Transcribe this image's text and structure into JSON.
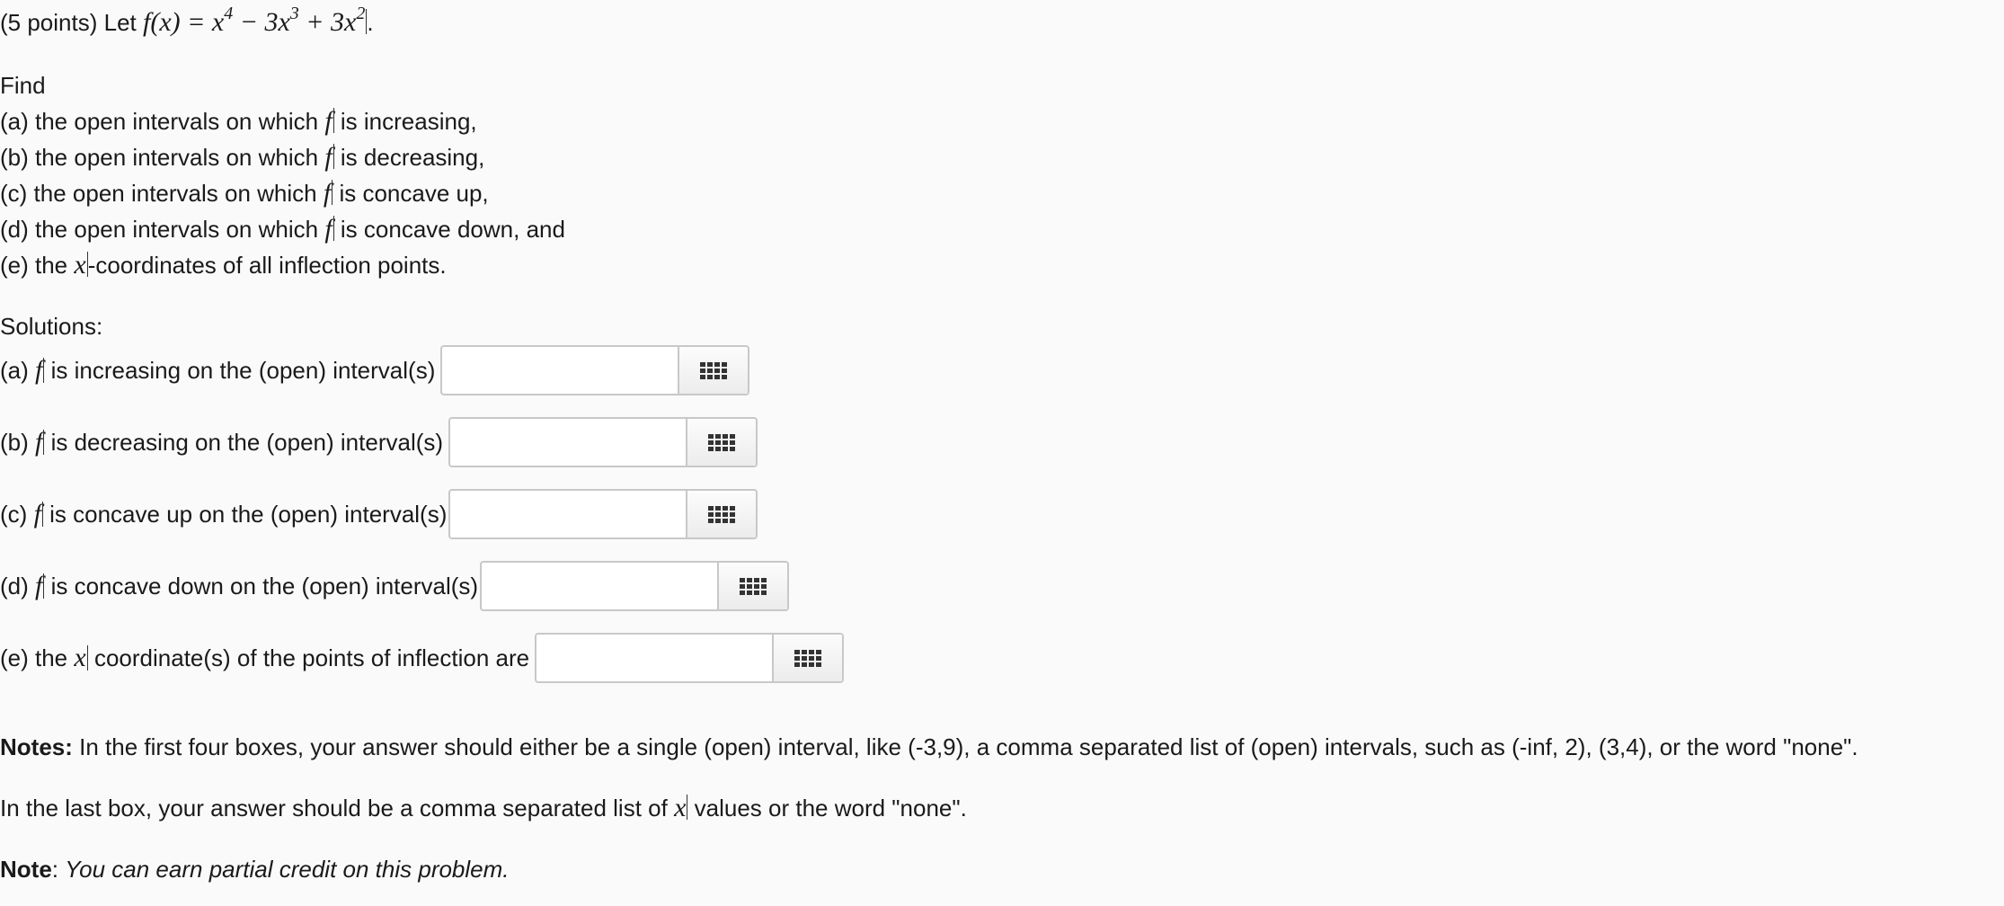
{
  "problem": {
    "points": "(5 points)",
    "let": "Let",
    "function": "f(x) = x",
    "exp4": "4",
    "minus": " − 3x",
    "exp3": "3",
    "plus": " + 3x",
    "exp2": "2",
    "period": "."
  },
  "find": {
    "heading": "Find",
    "items": [
      {
        "prefix": "(a) the open intervals on which",
        "var": "f",
        "suffix": "is increasing,"
      },
      {
        "prefix": "(b) the open intervals on which",
        "var": "f",
        "suffix": "is decreasing,"
      },
      {
        "prefix": "(c) the open intervals on which",
        "var": "f",
        "suffix": "is concave up,"
      },
      {
        "prefix": "(d) the open intervals on which",
        "var": "f",
        "suffix": "is concave down, and"
      },
      {
        "prefix": "(e) the",
        "var": "x",
        "suffix": "-coordinates of all inflection points."
      }
    ]
  },
  "solutions": {
    "heading": "Solutions:",
    "rows": [
      {
        "prefix": "(a)",
        "var": "f",
        "suffix": "is increasing on the (open) interval(s)",
        "value": ""
      },
      {
        "prefix": "(b)",
        "var": "f",
        "suffix": "is decreasing on the (open) interval(s)",
        "value": ""
      },
      {
        "prefix": "(c)",
        "var": "f",
        "suffix": "is concave up on the (open) interval(s)",
        "value": ""
      },
      {
        "prefix": "(d)",
        "var": "f",
        "suffix": "is concave down on the (open) interval(s)",
        "value": ""
      },
      {
        "prefix": "(e) the",
        "var": "x",
        "suffix": "coordinate(s) of the points of inflection are",
        "value": ""
      }
    ]
  },
  "notes": {
    "label": "Notes:",
    "first_four": " In the first four boxes, your answer should either be a single (open) interval, like (-3,9), a comma separated list of (open) intervals, such as (-inf, 2), (3,4), or the word \"none\".",
    "last_prefix": "In the last box, your answer should be a comma separated list of",
    "last_var": "x",
    "last_suffix": "values or the word \"none\".",
    "note_label": "Note",
    "note_colon": ": ",
    "note_text": "You can earn partial credit on this problem."
  }
}
